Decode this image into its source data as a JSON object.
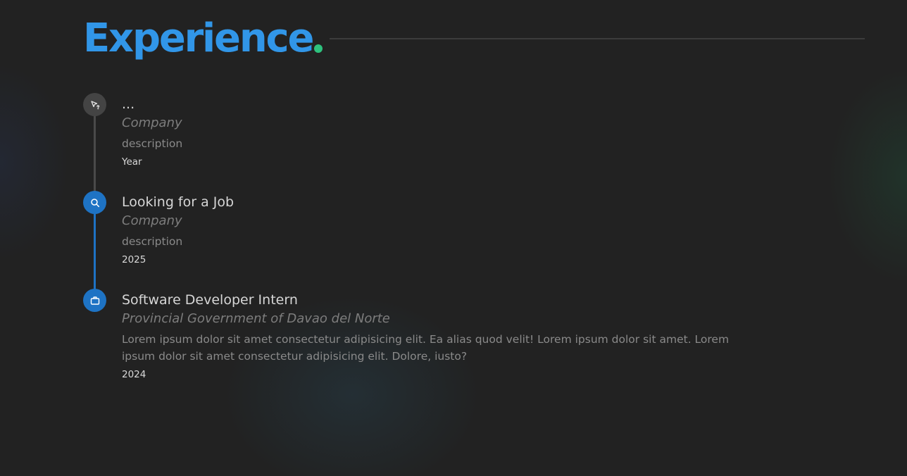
{
  "header": {
    "title": "Experience",
    "title_color": "#3196e8",
    "dot_color": "#2ec27e"
  },
  "timeline": {
    "line_colors": {
      "inactive": "#4a4a4a",
      "active": "#1e73c4"
    },
    "entries": [
      {
        "icon": "cursor-question-icon",
        "title": "...",
        "company": "Company",
        "description": "description",
        "year": "Year",
        "node_color": "#444444"
      },
      {
        "icon": "search-icon",
        "title": "Looking for a Job",
        "company": "Company",
        "description": "description",
        "year": "2025",
        "node_color": "#1e73c4"
      },
      {
        "icon": "briefcase-icon",
        "title": "Software Developer Intern",
        "company": "Provincial Government of Davao del Norte",
        "description": "Lorem ipsum dolor sit amet consectetur adipisicing elit. Ea alias quod velit! Lorem ipsum dolor sit amet. Lorem ipsum dolor sit amet consectetur adipisicing elit. Dolore, iusto?",
        "year": "2024",
        "node_color": "#1e73c4"
      }
    ]
  }
}
